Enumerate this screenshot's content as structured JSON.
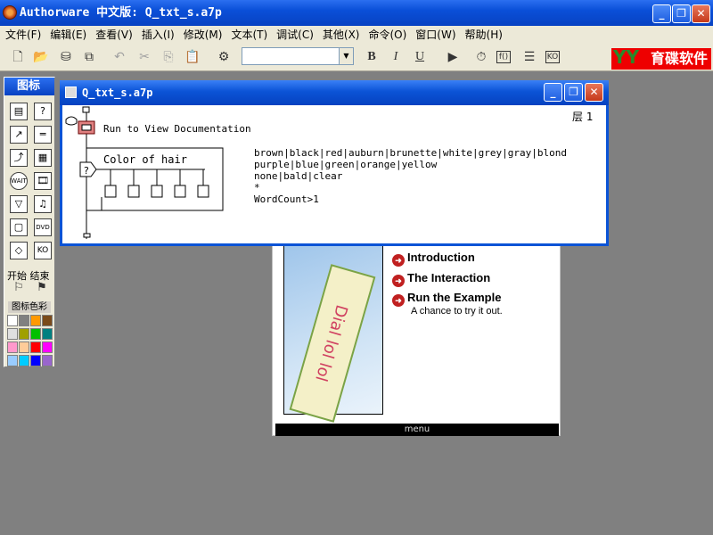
{
  "app": {
    "title": "Authorware 中文版: Q_txt_s.a7p"
  },
  "window_buttons": {
    "minimize": "_",
    "restore": "❐",
    "close": "✕"
  },
  "menu": [
    {
      "label": "文件(F)"
    },
    {
      "label": "编辑(E)"
    },
    {
      "label": "查看(V)"
    },
    {
      "label": "插入(I)"
    },
    {
      "label": "修改(M)"
    },
    {
      "label": "文本(T)"
    },
    {
      "label": "调试(C)"
    },
    {
      "label": "其他(X)"
    },
    {
      "label": "命令(O)"
    },
    {
      "label": "窗口(W)"
    },
    {
      "label": "帮助(H)"
    }
  ],
  "toolbar": {
    "font_value": "",
    "bold": "B",
    "italic": "I",
    "underline": "U",
    "icons": [
      "new-icon",
      "open-icon",
      "save-all-icon",
      "import-icon",
      "undo-icon",
      "cut-icon",
      "copy-icon",
      "paste-icon",
      "find-icon",
      "run-icon",
      "control-panel-icon",
      "functions-icon",
      "variables-icon",
      "knowledge-objects-icon"
    ]
  },
  "logo": {
    "text": "育碟软件",
    "mark": "YY"
  },
  "palette": {
    "title": "图标",
    "start_label": "开始",
    "end_label": "结束",
    "color_label": "图标色彩",
    "swatches": [
      "#ffffff",
      "#808080",
      "#ff9900",
      "#7a4a1a",
      "#e0e0e0",
      "#a0a000",
      "#00c000",
      "#008080",
      "#ff99cc",
      "#ffcc99",
      "#ff0000",
      "#ff00ff",
      "#99ccff",
      "#00ccff",
      "#0000ff",
      "#9966cc"
    ]
  },
  "flow_window": {
    "title": "Q_txt_s.a7p",
    "level": "层 1",
    "run_label": "Run to View Documentation",
    "interaction_label": "Color of hair",
    "responses": [
      "brown|black|red|auburn|brunette|white|grey|gray|blond",
      "purple|blue|green|orange|yellow",
      "none|bald|clear",
      "*",
      "WordCount>1"
    ]
  },
  "stage": {
    "artwork_text": "Dial lol lol",
    "items": [
      {
        "label": "Introduction"
      },
      {
        "label": "The Interaction"
      },
      {
        "label": "Run the Example"
      }
    ],
    "run_sub": "A chance to try it out.",
    "menu_label": "menu"
  },
  "colors": {
    "titlebar": "#0842c2",
    "close": "#c5391a",
    "accent_red": "#c02020"
  }
}
